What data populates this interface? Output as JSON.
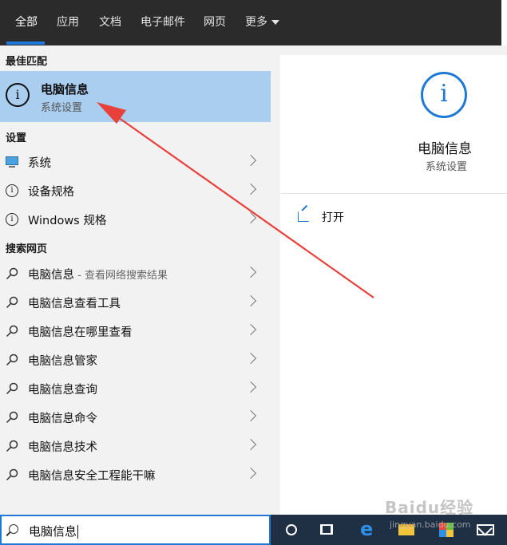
{
  "tabs": [
    {
      "label": "全部",
      "active": true
    },
    {
      "label": "应用"
    },
    {
      "label": "文档"
    },
    {
      "label": "电子邮件"
    },
    {
      "label": "网页"
    },
    {
      "label": "更多"
    }
  ],
  "best_match": {
    "header": "最佳匹配",
    "title": "电脑信息",
    "subtitle": "系统设置",
    "icon": "info-icon"
  },
  "settings": {
    "header": "设置",
    "items": [
      {
        "label": "系统",
        "icon": "monitor-icon"
      },
      {
        "label": "设备规格",
        "icon": "info-icon"
      },
      {
        "label": "Windows 规格",
        "icon": "info-icon"
      }
    ]
  },
  "web": {
    "header": "搜索网页",
    "first_label": "电脑信息",
    "first_suffix": " - 查看网络搜索结果",
    "items": [
      "电脑信息查看工具",
      "电脑信息在哪里查看",
      "电脑信息管家",
      "电脑信息查询",
      "电脑信息命令",
      "电脑信息技术",
      "电脑信息安全工程能干嘛"
    ]
  },
  "preview": {
    "title": "电脑信息",
    "subtitle": "系统设置",
    "open_label": "打开"
  },
  "search": {
    "value": "电脑信息"
  },
  "watermark": {
    "text": "Baidu经验",
    "sub": "jingyan.baidu.com"
  },
  "colors": {
    "accent": "#1e78d7",
    "selection": "#a9cef0",
    "annotation_arrow": "#e8403a",
    "taskbar": "#1f2f44"
  }
}
